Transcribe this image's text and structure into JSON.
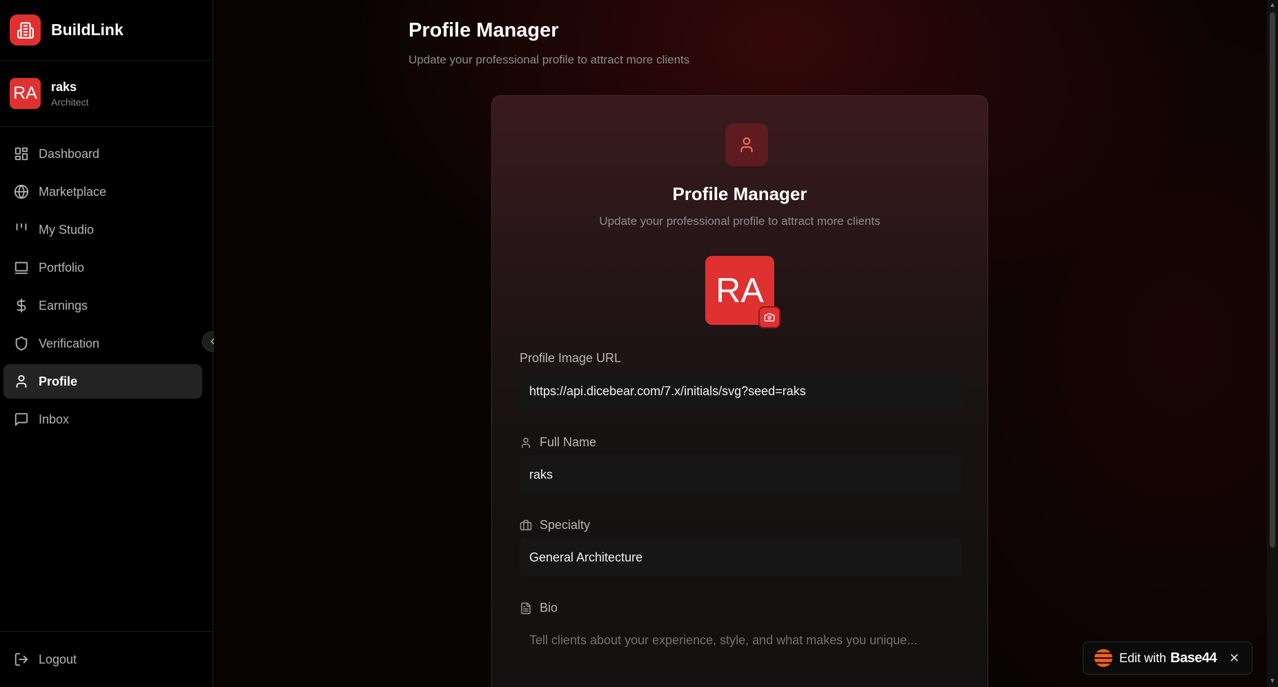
{
  "brand": {
    "name": "BuildLink"
  },
  "user": {
    "initials": "RA",
    "name": "raks",
    "role": "Architect"
  },
  "nav": {
    "items": [
      {
        "label": "Dashboard",
        "icon": "dashboard-icon"
      },
      {
        "label": "Marketplace",
        "icon": "globe-icon"
      },
      {
        "label": "My Studio",
        "icon": "studio-icon"
      },
      {
        "label": "Portfolio",
        "icon": "portfolio-icon"
      },
      {
        "label": "Earnings",
        "icon": "dollar-icon"
      },
      {
        "label": "Verification",
        "icon": "shield-icon"
      },
      {
        "label": "Profile",
        "icon": "user-icon",
        "active": true
      },
      {
        "label": "Inbox",
        "icon": "message-icon"
      }
    ],
    "logout": "Logout"
  },
  "header": {
    "title": "Profile Manager",
    "subtitle": "Update your professional profile to attract more clients"
  },
  "card": {
    "title": "Profile Manager",
    "subtitle": "Update your professional profile to attract more clients",
    "avatar_initials": "RA",
    "fields": {
      "image_url": {
        "label": "Profile Image URL",
        "value": "https://api.dicebear.com/7.x/initials/svg?seed=raks"
      },
      "full_name": {
        "label": "Full Name",
        "value": "raks"
      },
      "specialty": {
        "label": "Specialty",
        "value": "General Architecture"
      },
      "bio": {
        "label": "Bio",
        "placeholder": "Tell clients about your experience, style, and what makes you unique..."
      }
    }
  },
  "badge": {
    "text": "Edit with",
    "brand": "Base44",
    "close": "✕"
  },
  "colors": {
    "accent": "#e03131",
    "background": "#070303",
    "sidebar": "#000000"
  }
}
